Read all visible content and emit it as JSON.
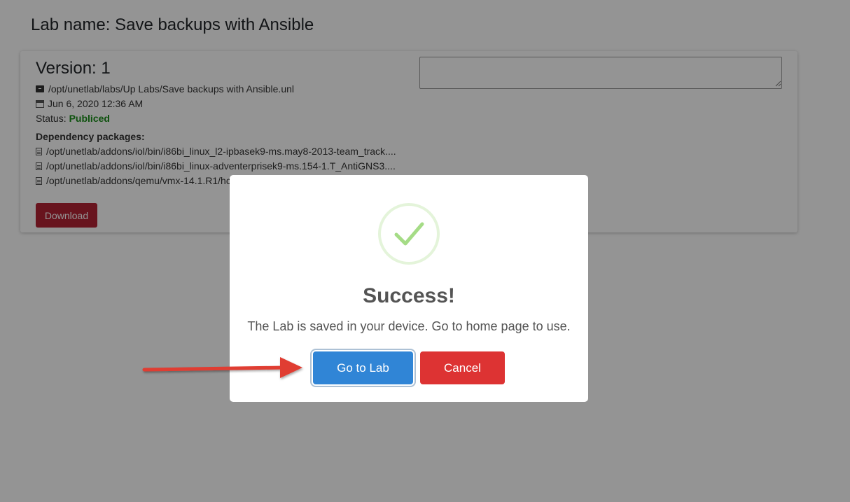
{
  "page": {
    "title": "Lab name: Save backups with Ansible"
  },
  "card": {
    "version": "Version: 1",
    "path": "/opt/unetlab/labs/Up Labs/Save backups with Ansible.unl",
    "date": "Jun 6, 2020 12:36 AM",
    "status_label": "Status:",
    "status_value": "Publiced",
    "dependency_title": "Dependency packages:",
    "dependencies": [
      "/opt/unetlab/addons/iol/bin/i86bi_linux_l2-ipbasek9-ms.may8-2013-team_track....",
      "/opt/unetlab/addons/iol/bin/i86bi_linux-adventerprisek9-ms.154-1.T_AntiGNS3....",
      "/opt/unetlab/addons/qemu/vmx-14.1.R1/hc"
    ],
    "download_label": "Download",
    "notes_value": ""
  },
  "modal": {
    "title": "Success!",
    "message": "The Lab is saved in your device. Go to home page to use.",
    "confirm_label": "Go to Lab",
    "cancel_label": "Cancel",
    "icon": "success-check-icon"
  },
  "colors": {
    "status_green": "#198d19",
    "download_red": "#b32434",
    "confirm_blue": "#3085d6",
    "cancel_red": "#dd3333",
    "arrow_red": "#e03c31"
  }
}
